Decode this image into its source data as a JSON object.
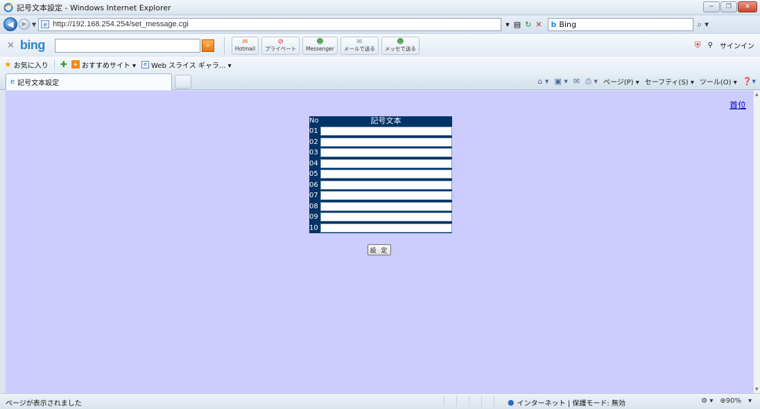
{
  "window": {
    "title": "記号文本設定 - Windows Internet Explorer"
  },
  "address": {
    "url": "http://192.168.254.254/set_message.cgi",
    "search_text": "Bing"
  },
  "bing_toolbar": {
    "logo": "bing",
    "buttons": [
      {
        "label": "Hotmail"
      },
      {
        "label": "プライベート"
      },
      {
        "label": "Messenger"
      },
      {
        "label": "メールで送る"
      },
      {
        "label": "メッセで送る"
      }
    ],
    "signin": "サインイン"
  },
  "favorites": {
    "label": "お気に入り",
    "suggested": "おすすめサイト ▾",
    "webslice": "Web スライス ギャラ... ▾"
  },
  "tab": {
    "title": "記号文本設定"
  },
  "command_bar": {
    "page": "ページ(P) ▾",
    "safety": "セーフティ(S) ▾",
    "tools": "ツール(O) ▾"
  },
  "page": {
    "top_link": "首位",
    "table": {
      "header_no": "No",
      "header_text": "記号文本",
      "rows": [
        {
          "no": "01",
          "value": ""
        },
        {
          "no": "02",
          "value": ""
        },
        {
          "no": "03",
          "value": ""
        },
        {
          "no": "04",
          "value": ""
        },
        {
          "no": "05",
          "value": ""
        },
        {
          "no": "06",
          "value": ""
        },
        {
          "no": "07",
          "value": ""
        },
        {
          "no": "08",
          "value": ""
        },
        {
          "no": "09",
          "value": ""
        },
        {
          "no": "10",
          "value": ""
        }
      ]
    },
    "submit_label": "設 定"
  },
  "status": {
    "message": "ページが表示されました",
    "zone": "インターネット | 保護モード: 無効",
    "zoom": "90%"
  },
  "colors": {
    "content_bg": "#ccccff",
    "table_header": "#003366",
    "link": "#0000cc"
  }
}
